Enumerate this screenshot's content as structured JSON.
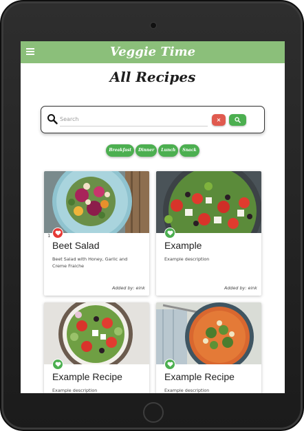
{
  "navbar": {
    "brand": "Veggie Time",
    "menu_icon": "hamburger-icon",
    "color": "#8bbf7a"
  },
  "page": {
    "title": "All Recipes"
  },
  "search": {
    "placeholder": "Search",
    "value": "",
    "clear_label": "×",
    "search_icon": "search-icon"
  },
  "filters": [
    {
      "label": "Breakfast"
    },
    {
      "label": "Dinner"
    },
    {
      "label": "Lunch"
    },
    {
      "label": "Snack"
    }
  ],
  "recipes": [
    {
      "title": "Beet Salad",
      "description": "Beet Salad with Honey, Garlic and Creme Fraiche",
      "author": "Added by: eink",
      "favorite_count": "1",
      "favorited": true,
      "badge_color": "#e53935",
      "image": "beet-salad-photo"
    },
    {
      "title": "Example",
      "description": "Example description",
      "author": "Added by: eink",
      "favorited": false,
      "badge_color": "#4caf50",
      "image": "greek-salad-photo"
    },
    {
      "title": "Example Recipe",
      "description": "Example description",
      "favorited": false,
      "badge_color": "#4caf50",
      "image": "salad-bowl-photo"
    },
    {
      "title": "Example Recipe",
      "description": "Example description",
      "favorited": false,
      "badge_color": "#4caf50",
      "image": "stew-bowl-photo"
    }
  ],
  "colors": {
    "accent": "#4caf50",
    "danger": "#e05a4f",
    "navbar": "#8bbf7a"
  }
}
